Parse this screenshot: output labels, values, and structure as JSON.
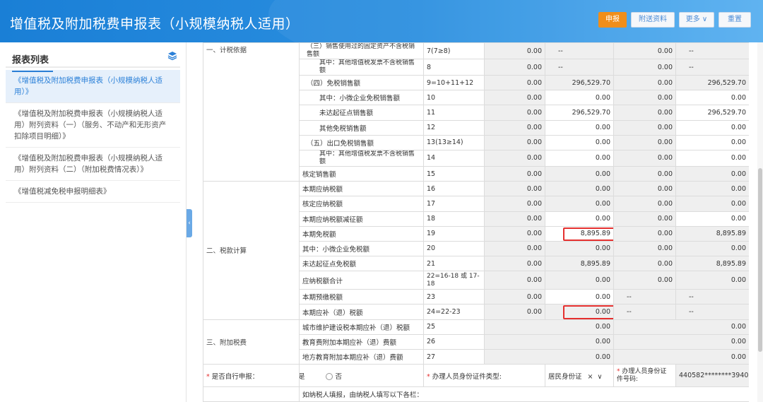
{
  "header": {
    "title": "增值税及附加税费申报表（小规模纳税人适用）",
    "buttons": [
      "申报",
      "附送资料",
      "更多",
      "重置"
    ]
  },
  "sidebar": {
    "title": "报表列表",
    "items": [
      "《增值税及附加税费申报表（小规模纳税人适用）》",
      "《增值税及附加税费申报表（小规模纳税人适用）附列资料（一）（服务、不动产和无形资产扣除项目明细）》",
      "《增值税及附加税费申报表（小规模纳税人适用）附列资料（二）（附加税费情况表）》",
      "《增值税减免税申报明细表》"
    ]
  },
  "sections": {
    "s1": "一、计税依据",
    "s2": "二、税款计算",
    "s3": "三、附加税费"
  },
  "rows": [
    {
      "item": "（三）销售使用过的固定资产不含税销售额",
      "line": "7(7≥8)",
      "c1": "0.00",
      "c2": "--",
      "c3": "0.00",
      "c4": "--"
    },
    {
      "item": "其中：其他增值税发票不含税销售额",
      "line": "8",
      "c1": "0.00",
      "c2": "--",
      "c3": "0.00",
      "c4": "--"
    },
    {
      "item": "（四）免税销售额",
      "line": "9=10+11+12",
      "c1": "0.00",
      "c2": "296,529.70",
      "c3": "0.00",
      "c4": "296,529.70"
    },
    {
      "item": "其中：小微企业免税销售额",
      "line": "10",
      "c1": "0.00",
      "c2": "0.00",
      "c3": "0.00",
      "c4": "0.00"
    },
    {
      "item": "未达起征点销售额",
      "line": "11",
      "c1": "0.00",
      "c2": "296,529.70",
      "c3": "0.00",
      "c4": "296,529.70"
    },
    {
      "item": "其他免税销售额",
      "line": "12",
      "c1": "0.00",
      "c2": "0.00",
      "c3": "0.00",
      "c4": "0.00"
    },
    {
      "item": "（五）出口免税销售额",
      "line": "13(13≥14)",
      "c1": "0.00",
      "c2": "0.00",
      "c3": "0.00",
      "c4": "0.00"
    },
    {
      "item": "其中：其他增值税发票不含税销售额",
      "line": "14",
      "c1": "0.00",
      "c2": "0.00",
      "c3": "0.00",
      "c4": "0.00"
    },
    {
      "item": "核定销售额",
      "line": "15",
      "c1": "0.00",
      "c2": "0.00",
      "c3": "0.00",
      "c4": "0.00"
    },
    {
      "item": "本期应纳税额",
      "line": "16",
      "c1": "0.00",
      "c2": "0.00",
      "c3": "0.00",
      "c4": "0.00"
    },
    {
      "item": "核定应纳税额",
      "line": "17",
      "c1": "0.00",
      "c2": "0.00",
      "c3": "0.00",
      "c4": "0.00"
    },
    {
      "item": "本期应纳税额减征额",
      "line": "18",
      "c1": "0.00",
      "c2": "0.00",
      "c3": "0.00",
      "c4": "0.00"
    },
    {
      "item": "本期免税额",
      "line": "19",
      "c1": "0.00",
      "c2": "8,895.89",
      "c3": "0.00",
      "c4": "8,895.89"
    },
    {
      "item": "其中：小微企业免税额",
      "line": "20",
      "c1": "0.00",
      "c2": "0.00",
      "c3": "0.00",
      "c4": "0.00"
    },
    {
      "item": "未达起征点免税额",
      "line": "21",
      "c1": "0.00",
      "c2": "8,895.89",
      "c3": "0.00",
      "c4": "8,895.89"
    },
    {
      "item": "应纳税额合计",
      "line": "22=16-18 或 17-18",
      "c1": "0.00",
      "c2": "0.00",
      "c3": "0.00",
      "c4": "0.00"
    },
    {
      "item": "本期预缴税额",
      "line": "23",
      "c1": "0.00",
      "c2": "0.00",
      "c3": "--",
      "c4": "--"
    },
    {
      "item": "本期应补（退）税额",
      "line": "24=22-23",
      "c1": "0.00",
      "c2": "0.00",
      "c3": "--",
      "c4": "--"
    },
    {
      "item": "城市维护建设税本期应补（退）税额",
      "line": "25",
      "c12": "0.00",
      "c34": "0.00"
    },
    {
      "item": "教育费附加本期应补（退）费额",
      "line": "26",
      "c12": "0.00",
      "c34": "0.00"
    },
    {
      "item": "地方教育附加本期应补（退）费额",
      "line": "27",
      "c12": "0.00",
      "c34": "0.00"
    }
  ],
  "declaration": {
    "self_label": "是否自行申报：",
    "yes": "是",
    "no": "否",
    "id_type_label": "办理人员身份证件类型:",
    "id_type_value": "居民身份证",
    "id_no_label": "办理人员身份证件号码:",
    "id_no_value": "440582********3940",
    "agent_note": "如纳税人填报，由纳税人填写以下各栏："
  },
  "colors": {
    "accent": "#2b80d8",
    "primary_btn": "#f08e1a",
    "highlight": "#e5302f"
  }
}
